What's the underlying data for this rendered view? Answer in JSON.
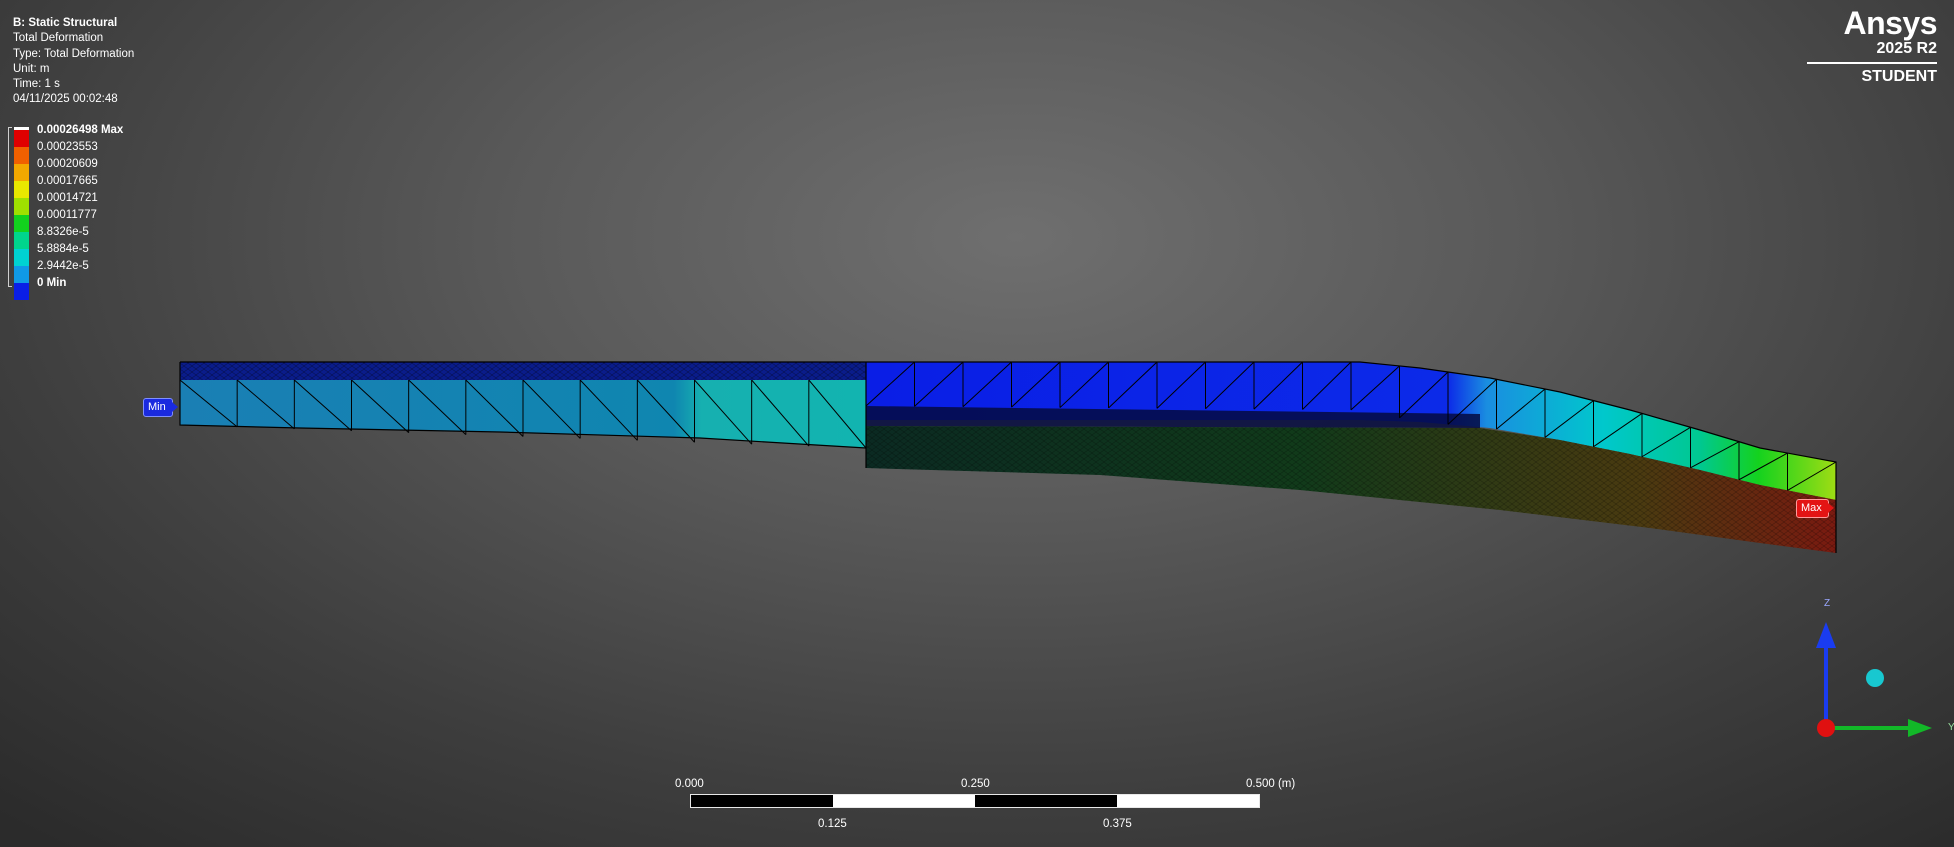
{
  "info": {
    "analysis": "B: Static Structural",
    "result": "Total Deformation",
    "type": "Type: Total Deformation",
    "unit": "Unit: m",
    "time": "Time: 1 s",
    "timestamp": "04/11/2025 00:02:48"
  },
  "legend": {
    "items": [
      {
        "label": "0.00026498 Max",
        "color": "#e00000",
        "bold": true
      },
      {
        "label": "0.00023553",
        "color": "#f06000",
        "bold": false
      },
      {
        "label": "0.00020609",
        "color": "#f2a800",
        "bold": false
      },
      {
        "label": "0.00017665",
        "color": "#e8e800",
        "bold": false
      },
      {
        "label": "0.00014721",
        "color": "#9fe000",
        "bold": false
      },
      {
        "label": "0.00011777",
        "color": "#12d21e",
        "bold": false
      },
      {
        "label": "8.8326e-5",
        "color": "#00d58c",
        "bold": false
      },
      {
        "label": "5.8884e-5",
        "color": "#00d2d2",
        "bold": false
      },
      {
        "label": "2.9442e-5",
        "color": "#1099e6",
        "bold": false
      },
      {
        "label": "0 Min",
        "color": "#0a1ee6",
        "bold": true
      }
    ]
  },
  "logo": {
    "name": "Ansys",
    "version": "2025 R2",
    "edition": "STUDENT"
  },
  "scale": {
    "label_0": "0.000",
    "label_250": "0.250",
    "label_500": "0.500 (m)",
    "label_125": "0.125",
    "label_375": "0.375"
  },
  "probes": {
    "min_label": "Min",
    "max_label": "Max"
  },
  "triad": {
    "z_label": "Z",
    "y_label": "Y"
  },
  "colors": {
    "min": "#0a1ee6",
    "max": "#e00000",
    "axis_z": "#1a3cf0",
    "axis_y": "#12b828",
    "axis_x": "#e01010"
  }
}
